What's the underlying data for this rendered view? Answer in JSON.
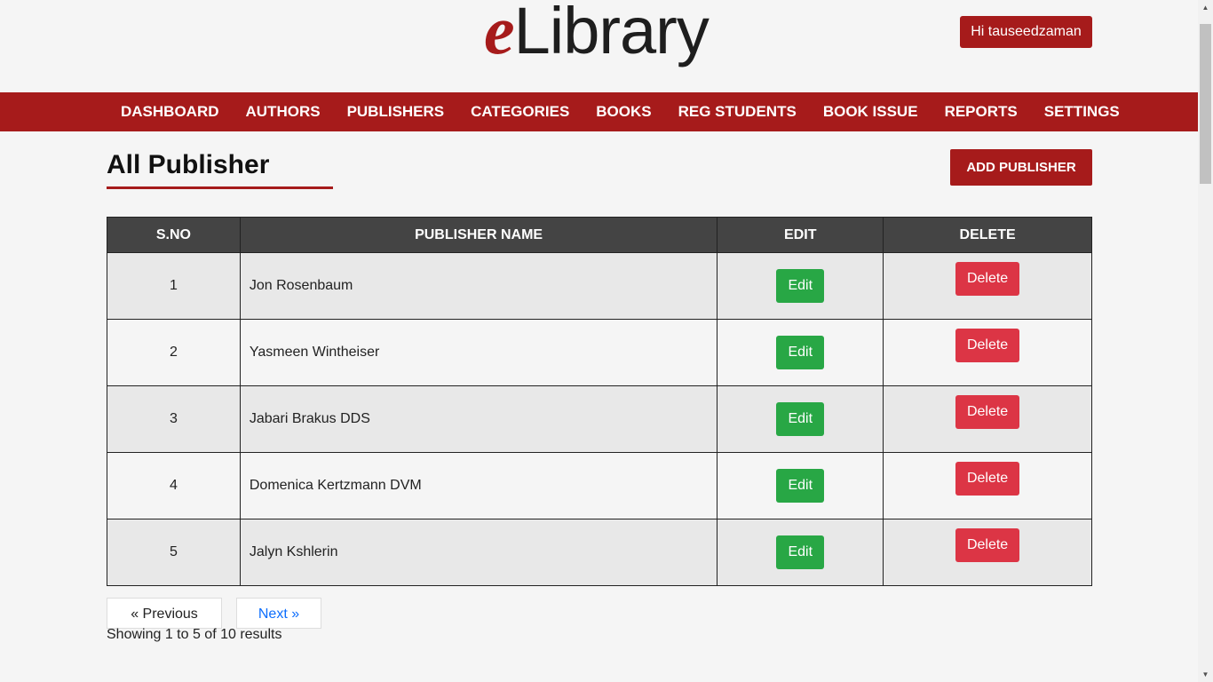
{
  "header": {
    "logo_e": "e",
    "logo_rest": "Library",
    "user_greeting": "Hi tauseedzaman"
  },
  "nav": {
    "items": [
      {
        "label": "DASHBOARD"
      },
      {
        "label": "AUTHORS"
      },
      {
        "label": "PUBLISHERS"
      },
      {
        "label": "CATEGORIES"
      },
      {
        "label": "BOOKS"
      },
      {
        "label": "REG STUDENTS"
      },
      {
        "label": "BOOK ISSUE"
      },
      {
        "label": "REPORTS"
      },
      {
        "label": "SETTINGS"
      }
    ]
  },
  "main": {
    "title": "All Publisher",
    "add_button": "ADD PUBLISHER"
  },
  "table": {
    "headers": {
      "sno": "S.NO",
      "name": "PUBLISHER NAME",
      "edit": "EDIT",
      "delete": "DELETE"
    },
    "rows": [
      {
        "sno": "1",
        "name": "Jon Rosenbaum",
        "edit": "Edit",
        "delete": "Delete"
      },
      {
        "sno": "2",
        "name": "Yasmeen Wintheiser",
        "edit": "Edit",
        "delete": "Delete"
      },
      {
        "sno": "3",
        "name": "Jabari Brakus DDS",
        "edit": "Edit",
        "delete": "Delete"
      },
      {
        "sno": "4",
        "name": "Domenica Kertzmann DVM",
        "edit": "Edit",
        "delete": "Delete"
      },
      {
        "sno": "5",
        "name": "Jalyn Kshlerin",
        "edit": "Edit",
        "delete": "Delete"
      }
    ]
  },
  "pagination": {
    "previous": "« Previous",
    "next": "Next »",
    "summary": "Showing 1 to 5 of 10 results"
  },
  "colors": {
    "brand": "#a61b1b",
    "edit": "#28a745",
    "delete": "#dc3545",
    "link": "#0d6efd"
  }
}
